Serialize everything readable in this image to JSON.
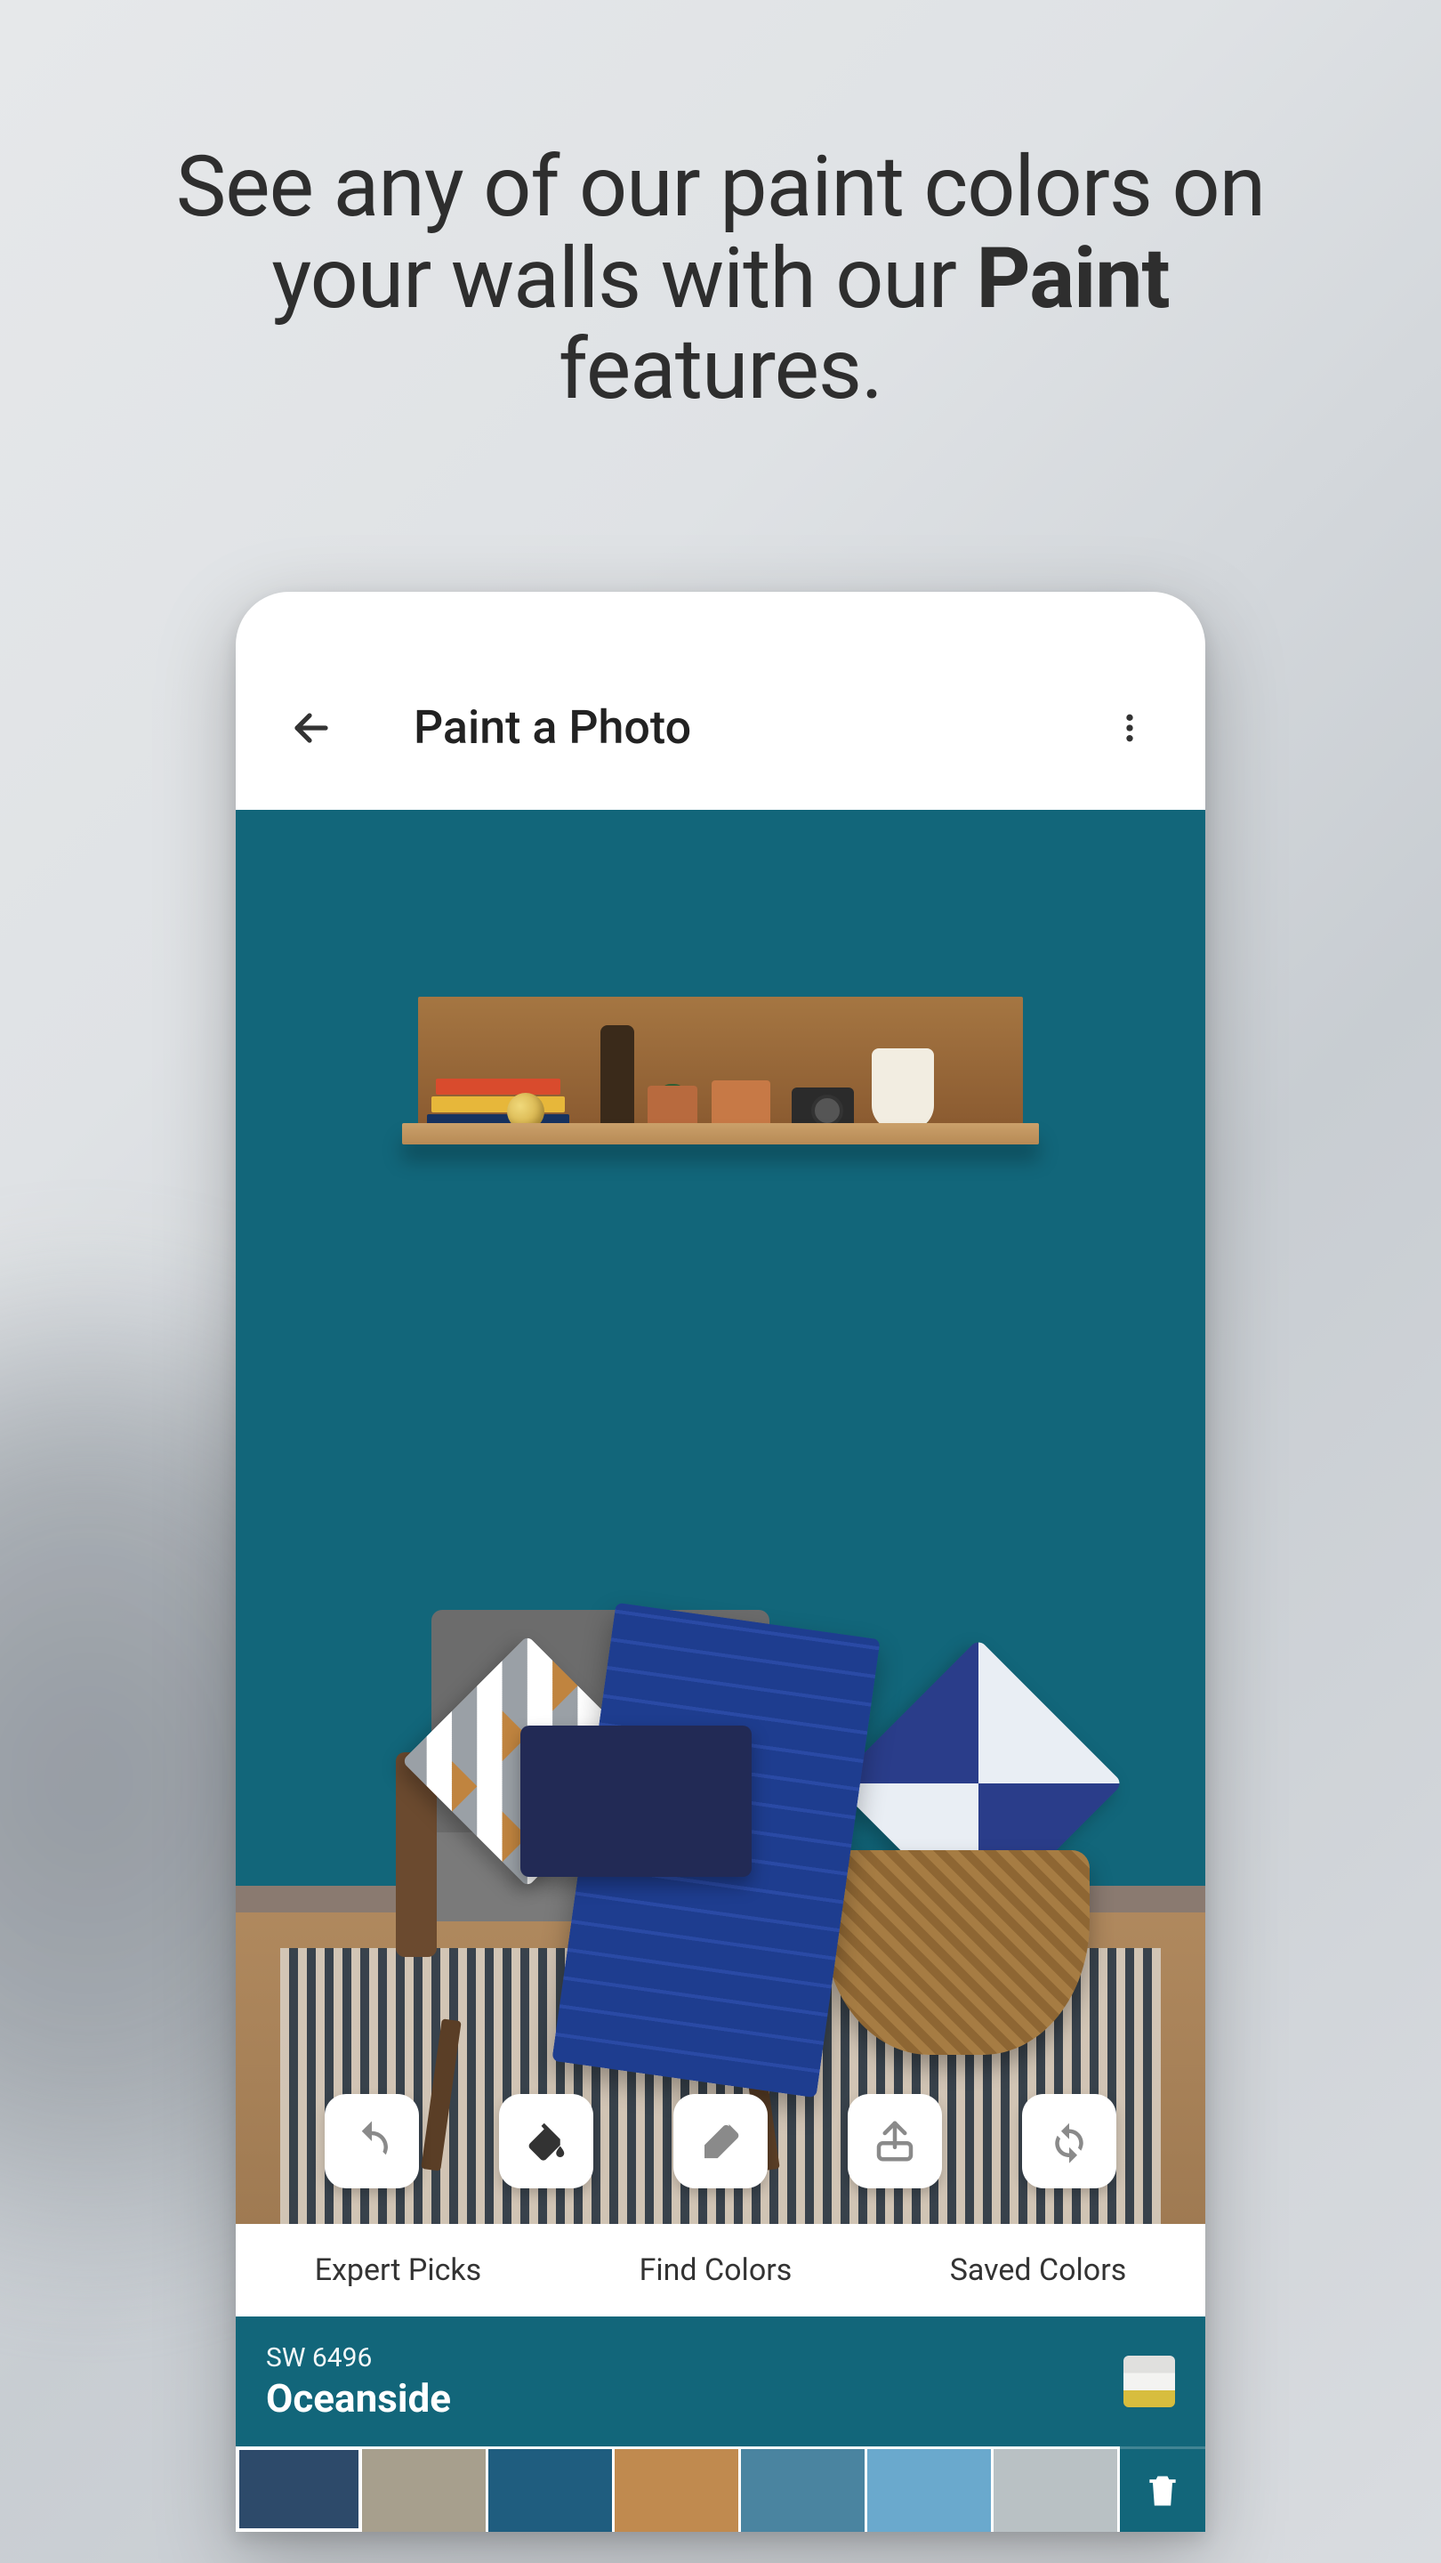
{
  "headline": {
    "pre": "See any of our paint colors on your walls with our ",
    "bold": "Paint",
    "post": " features."
  },
  "app_bar": {
    "title": "Paint a Photo"
  },
  "tools": {
    "undo": "undo",
    "paint": "paint",
    "erase": "erase",
    "share": "share",
    "reset": "reset"
  },
  "tabs": {
    "expert_picks": "Expert Picks",
    "find_colors": "Find Colors",
    "saved_colors": "Saved Colors"
  },
  "current_color": {
    "code": "SW 6496",
    "name": "Oceanside",
    "hex": "#12667a"
  },
  "palette": [
    {
      "hex": "#2d4a6a",
      "selected": true
    },
    {
      "hex": "#a79f8d",
      "selected": false
    },
    {
      "hex": "#1f5d7f",
      "selected": false
    },
    {
      "hex": "#c08a4f",
      "selected": false
    },
    {
      "hex": "#4a84a0",
      "selected": false
    },
    {
      "hex": "#6aa9cd",
      "selected": false
    },
    {
      "hex": "#b9c1c4",
      "selected": false
    }
  ]
}
